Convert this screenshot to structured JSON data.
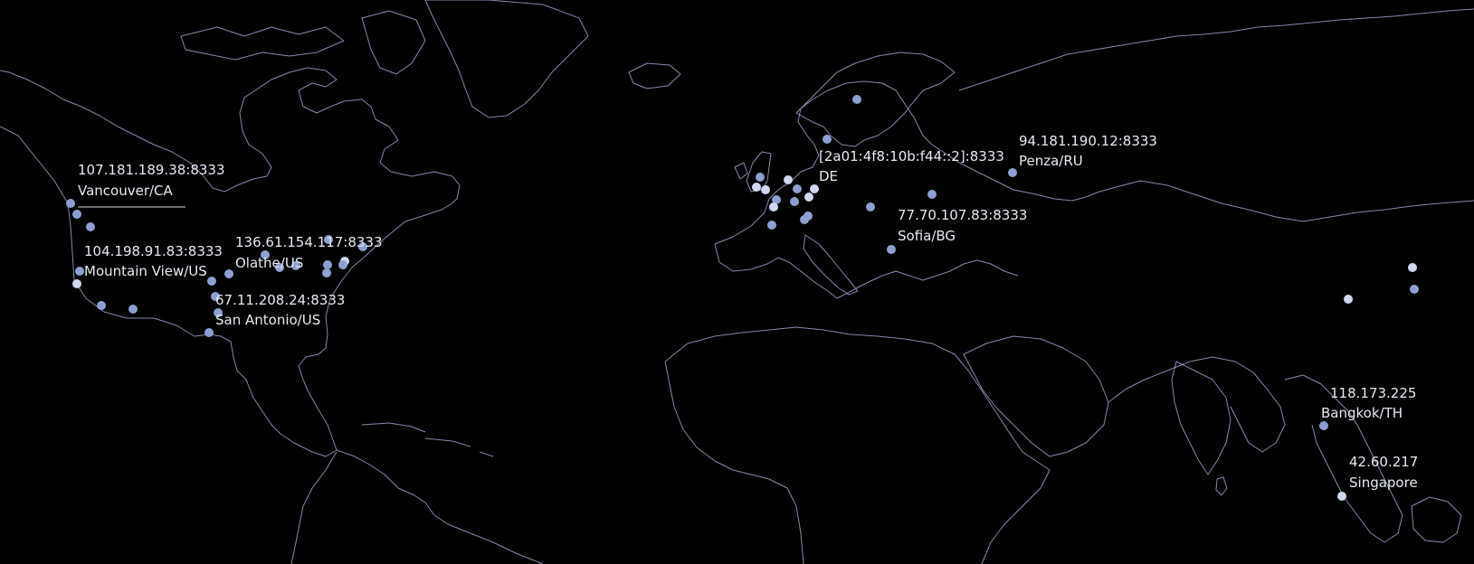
{
  "map": {
    "theme": "dark",
    "background_color": "#000000",
    "coastline_color": "#9aa0c8",
    "node_color": "#8e9fd0",
    "node_highlight_color": "#cfd8ee",
    "label_color": "#e6e9f2"
  },
  "labeled_nodes": [
    {
      "id": "vancouver",
      "address": "107.181.189.38:8333",
      "location": "Vancouver/CA"
    },
    {
      "id": "mountain-view",
      "address": "104.198.91.83:8333",
      "location": "Mountain View/US"
    },
    {
      "id": "olathe",
      "address": "136.61.154.117:8333",
      "location": "Olathe/US"
    },
    {
      "id": "san-antonio",
      "address": "67.11.208.24:8333",
      "location": "San Antonio/US"
    },
    {
      "id": "de",
      "address": "[2a01:4f8:10b:f44::2]:8333",
      "location": "DE"
    },
    {
      "id": "penza",
      "address": "94.181.190.12:8333",
      "location": "Penza/RU"
    },
    {
      "id": "sofia",
      "address": "77.70.107.83:8333",
      "location": "Sofia/BG"
    },
    {
      "id": "bangkok",
      "address": "118.173.225",
      "location": "Bangkok/TH"
    },
    {
      "id": "singapore",
      "address": "42.60.217",
      "location": "Singapore"
    }
  ]
}
